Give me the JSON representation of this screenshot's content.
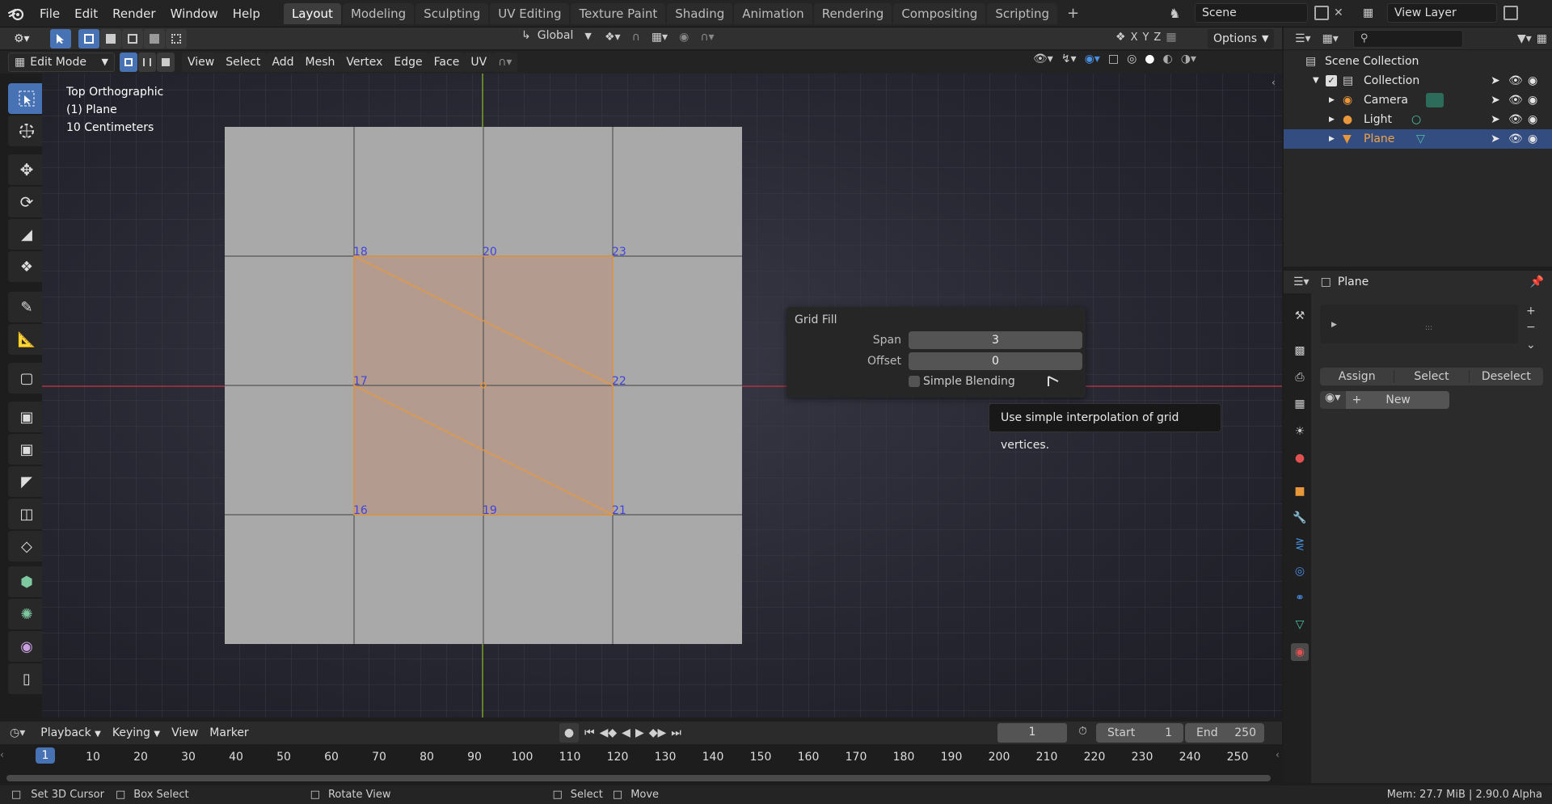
{
  "menubar": {
    "items": [
      "File",
      "Edit",
      "Render",
      "Window",
      "Help"
    ]
  },
  "workspaces": {
    "tabs": [
      "Layout",
      "Modeling",
      "Sculpting",
      "UV Editing",
      "Texture Paint",
      "Shading",
      "Animation",
      "Rendering",
      "Compositing",
      "Scripting"
    ],
    "active": "Layout",
    "add": "+"
  },
  "scene": {
    "label": "Scene"
  },
  "view_layer": {
    "label": "View Layer"
  },
  "tool_header": {
    "transform_orientation": "Global",
    "options": "Options",
    "axes": [
      "X",
      "Y",
      "Z"
    ]
  },
  "view_header": {
    "mode": "Edit Mode",
    "menus": [
      "View",
      "Select",
      "Add",
      "Mesh",
      "Vertex",
      "Edge",
      "Face",
      "UV"
    ]
  },
  "viewport": {
    "info": [
      "Top Orthographic",
      "(1) Plane",
      "10 Centimeters"
    ],
    "vertex_labels": [
      "18",
      "20",
      "23",
      "17",
      "22",
      "16",
      "19",
      "21"
    ]
  },
  "grid_fill": {
    "title": "Grid Fill",
    "span_label": "Span",
    "span_value": "3",
    "offset_label": "Offset",
    "offset_value": "0",
    "simple_blending": "Simple Blending",
    "simple_blending_checked": false
  },
  "tooltip": {
    "text": "Use simple interpolation of grid vertices."
  },
  "outliner": {
    "root": "Scene Collection",
    "collection": "Collection",
    "items": [
      "Camera",
      "Light",
      "Plane"
    ],
    "selected": "Plane"
  },
  "properties": {
    "object": "Plane",
    "assign": "Assign",
    "select": "Select",
    "deselect": "Deselect",
    "new": "New",
    "handle": ":::"
  },
  "timeline": {
    "menus": [
      "Playback",
      "Keying",
      "View",
      "Marker"
    ],
    "current_frame": "1",
    "start_label": "Start",
    "start": "1",
    "end_label": "End",
    "end": "250",
    "ticks": [
      "10",
      "20",
      "30",
      "40",
      "50",
      "60",
      "70",
      "80",
      "90",
      "100",
      "110",
      "120",
      "130",
      "140",
      "150",
      "160",
      "170",
      "180",
      "190",
      "200",
      "210",
      "220",
      "230",
      "240",
      "250"
    ],
    "frame_marker": "1"
  },
  "statusbar": {
    "items": [
      "Set 3D Cursor",
      "Box Select",
      "Rotate View",
      "Select",
      "Move"
    ],
    "mem": "Mem: 27.7 MiB | 2.90.0 Alpha"
  },
  "colors": {
    "accent": "#4772b3",
    "selection_orange": "#e8973b",
    "x_axis": "#b0333f",
    "y_axis": "#79a022",
    "vertex_label": "#4242e0"
  }
}
